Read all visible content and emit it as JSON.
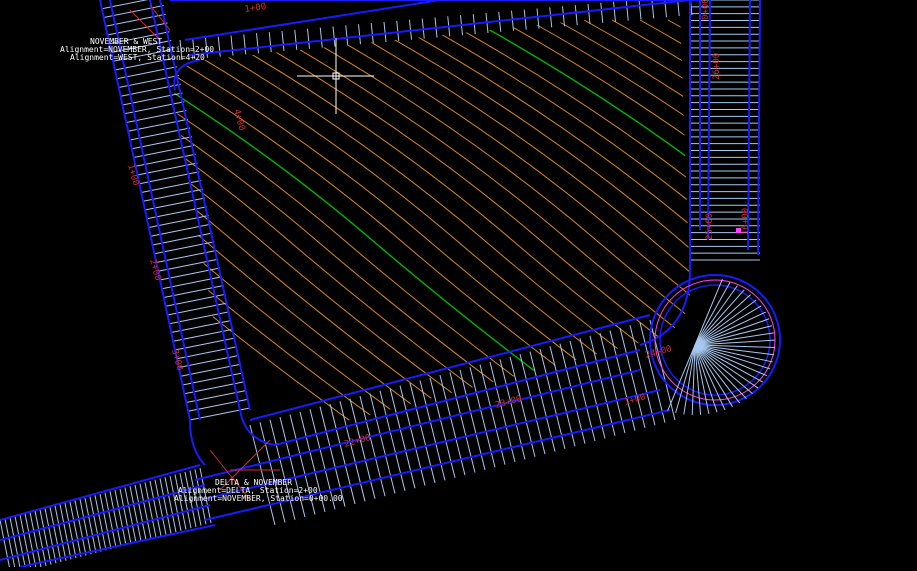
{
  "app": {
    "view": "model-space-drawing"
  },
  "colors": {
    "background": "#000000",
    "road_edge": "#1a1aff",
    "road_section": "#a8c8ee",
    "contour_minor": "#d9891a",
    "contour_major": "#00b400",
    "station_label": "#d03030",
    "annotation_text": "#ffffff",
    "crosshair": "#ffffff",
    "marker": "#ff40ff"
  },
  "labels": {
    "intersection_top": {
      "line1": "NOVEMBER & WEST",
      "line2": "Alignment=NOVEMBER, Station=2+00",
      "line3": "Alignment=WEST, Station=4+20"
    },
    "intersection_bottom": {
      "line1": "DELTA & NOVEMBER",
      "line2": "Alignment=DELTA, Station=2+00",
      "line3": "Alignment=NOVEMBER, Station=0+00.00"
    }
  },
  "stations": {
    "top_1": "1+00",
    "top_2": "0+00",
    "right_1": "26+00",
    "right_2": "25+00",
    "right_3": "16+00",
    "bottom_1": "24+00",
    "bottom_2": "23+00",
    "bottom_3": "22+00",
    "bottom_4": "1+00",
    "left_1": "1+00",
    "left_2": "2+00",
    "left_3": "3+00",
    "left_4": "4+00"
  },
  "crosshair": {
    "tool": "cursor-crosshair"
  }
}
